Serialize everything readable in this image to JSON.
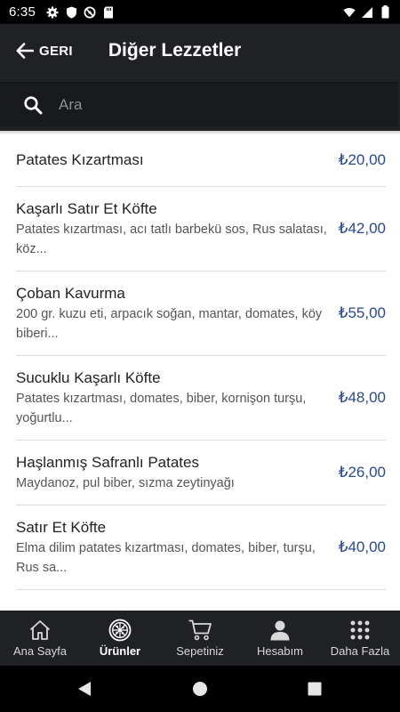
{
  "status_bar": {
    "time": "6:35",
    "left_icons": [
      "gear-icon",
      "shield-icon",
      "no-sync-icon",
      "sd-card-icon"
    ],
    "right_icons": [
      "wifi-icon",
      "signal-icon",
      "battery-icon"
    ]
  },
  "header": {
    "back_label": "GERI",
    "title": "Diğer Lezzetler"
  },
  "search": {
    "placeholder": "Ara",
    "value": ""
  },
  "products": [
    {
      "name": "Patates Kızartması",
      "description": "",
      "price": "₺20,00"
    },
    {
      "name": "Kaşarlı Satır Et Köfte",
      "description": "Patates kızartması, acı tatlı barbekü sos, Rus salatası, köz...",
      "price": "₺42,00"
    },
    {
      "name": "Çoban Kavurma",
      "description": "200 gr. kuzu eti, arpacık soğan, mantar, domates, köy biberi...",
      "price": "₺55,00"
    },
    {
      "name": "Sucuklu Kaşarlı Köfte",
      "description": "Patates kızartması, domates, biber, kornişon turşu, yoğurtlu...",
      "price": "₺48,00"
    },
    {
      "name": "Haşlanmış Safranlı Patates",
      "description": "Maydanoz, pul biber, sızma zeytinyağı",
      "price": "₺26,00"
    },
    {
      "name": "Satır Et Köfte",
      "description": "Elma dilim patates kızartması, domates, biber, turşu, Rus sa...",
      "price": "₺40,00"
    }
  ],
  "bottom_nav": [
    {
      "label": "Ana Sayfa",
      "icon": "home-icon",
      "active": false
    },
    {
      "label": "Ürünler",
      "icon": "pizza-icon",
      "active": true
    },
    {
      "label": "Sepetiniz",
      "icon": "cart-icon",
      "active": false
    },
    {
      "label": "Hesabım",
      "icon": "user-icon",
      "active": false
    },
    {
      "label": "Daha Fazla",
      "icon": "grid-icon",
      "active": false
    }
  ],
  "system_nav": [
    "back-triangle-icon",
    "home-circle-icon",
    "recents-square-icon"
  ],
  "colors": {
    "header_bg": "#1f2125",
    "price": "#2a4a8a",
    "status_bar_bg": "#000000"
  }
}
